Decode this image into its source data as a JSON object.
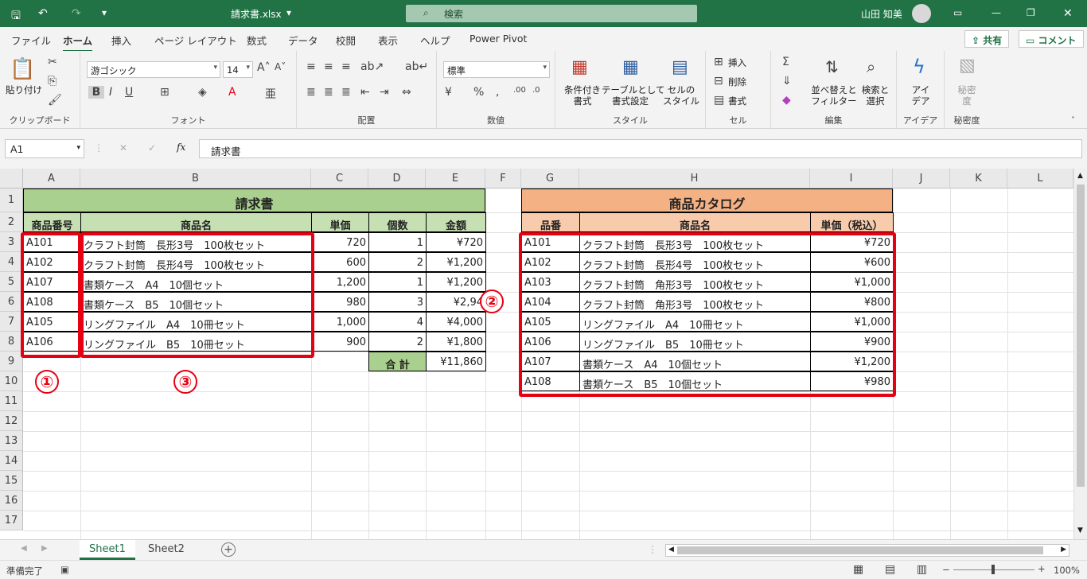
{
  "titlebar": {
    "filename": "請求書.xlsx",
    "search_placeholder": "検索",
    "user": "山田 知美",
    "colors": {
      "brand": "#217346"
    }
  },
  "ribbon_tabs": [
    "ファイル",
    "ホーム",
    "挿入",
    "ページ レイアウト",
    "数式",
    "データ",
    "校閲",
    "表示",
    "ヘルプ",
    "Power Pivot"
  ],
  "active_tab": "ホーム",
  "share_label": "共有",
  "comment_label": "コメント",
  "ribbon": {
    "clipboard": {
      "paste": "貼り付け",
      "label": "クリップボード"
    },
    "font": {
      "name": "游ゴシック",
      "size": "14",
      "label": "フォント"
    },
    "alignment": {
      "label": "配置"
    },
    "number": {
      "format": "標準",
      "label": "数値"
    },
    "styles": {
      "cond": "条件付き\n書式",
      "table": "テーブルとして\n書式設定",
      "cell": "セルの\nスタイル",
      "label": "スタイル"
    },
    "cells": {
      "insert": "挿入",
      "delete": "削除",
      "format": "書式",
      "label": "セル"
    },
    "editing": {
      "sort": "並べ替えと\nフィルター",
      "find": "検索と\n選択",
      "label": "編集"
    },
    "ideas": {
      "btn": "アイ\nデア",
      "label": "アイデア"
    },
    "sensitivity": {
      "btn": "秘密\n度",
      "label": "秘密度"
    }
  },
  "formula_bar": {
    "name_box": "A1",
    "formula": "請求書"
  },
  "columns": [
    "A",
    "B",
    "C",
    "D",
    "E",
    "F",
    "G",
    "H",
    "I",
    "J",
    "K",
    "L"
  ],
  "rows": [
    "1",
    "2",
    "3",
    "4",
    "5",
    "6",
    "7",
    "8",
    "9",
    "10",
    "11",
    "12",
    "13",
    "14",
    "15",
    "16",
    "17"
  ],
  "invoice": {
    "title": "請求書",
    "headers": [
      "商品番号",
      "商品名",
      "単価",
      "個数",
      "金額"
    ],
    "rows": [
      [
        "A101",
        "クラフト封筒　長形3号　100枚セット",
        "720",
        "1",
        "¥720"
      ],
      [
        "A102",
        "クラフト封筒　長形4号　100枚セット",
        "600",
        "2",
        "¥1,200"
      ],
      [
        "A107",
        "書類ケース　A4　10個セット",
        "1,200",
        "1",
        "¥1,200"
      ],
      [
        "A108",
        "書類ケース　B5　10個セット",
        "980",
        "3",
        "¥2,94"
      ],
      [
        "A105",
        "リングファイル　A4　10冊セット",
        "1,000",
        "4",
        "¥4,000"
      ],
      [
        "A106",
        "リングファイル　B5　10冊セット",
        "900",
        "2",
        "¥1,800"
      ]
    ],
    "total_label": "合 計",
    "total_value": "¥11,860"
  },
  "catalog": {
    "title": "商品カタログ",
    "headers": [
      "品番",
      "商品名",
      "単価（税込）"
    ],
    "rows": [
      [
        "A101",
        "クラフト封筒　長形3号　100枚セット",
        "¥720"
      ],
      [
        "A102",
        "クラフト封筒　長形4号　100枚セット",
        "¥600"
      ],
      [
        "A103",
        "クラフト封筒　角形3号　100枚セット",
        "¥1,000"
      ],
      [
        "A104",
        "クラフト封筒　角形3号　100枚セット",
        "¥800"
      ],
      [
        "A105",
        "リングファイル　A4　10冊セット",
        "¥1,000"
      ],
      [
        "A106",
        "リングファイル　B5　10冊セット",
        "¥900"
      ],
      [
        "A107",
        "書類ケース　A4　10個セット",
        "¥1,200"
      ],
      [
        "A108",
        "書類ケース　B5　10個セット",
        "¥980"
      ]
    ]
  },
  "annotations": [
    "①",
    "②",
    "③"
  ],
  "sheets": [
    "Sheet1",
    "Sheet2"
  ],
  "status": {
    "ready": "準備完了",
    "zoom": "100%"
  }
}
